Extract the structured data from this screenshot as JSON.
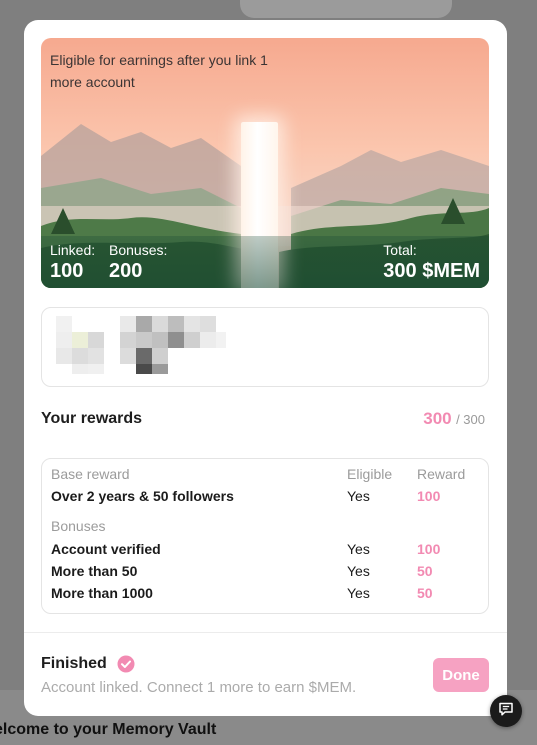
{
  "hero": {
    "eligibility_text": "Eligible for earnings after you link 1 more account",
    "linked_label": "Linked:",
    "linked_value": "100",
    "bonuses_label": "Bonuses:",
    "bonuses_value": "200",
    "total_label": "Total:",
    "total_value": "300 $MEM"
  },
  "rewards": {
    "title": "Your rewards",
    "score": "300",
    "score_max": "/ 300",
    "score_color": "#f28ab2"
  },
  "table": {
    "base_header": "Base reward",
    "eligible_header": "Eligible",
    "reward_header": "Reward",
    "base_rows": [
      {
        "name": "Over 2 years & 50 followers",
        "eligible": "Yes",
        "reward": "100"
      }
    ],
    "bonuses_header": "Bonuses",
    "bonus_rows": [
      {
        "name": "Account verified",
        "eligible": "Yes",
        "reward": "100"
      },
      {
        "name": "More than 50",
        "eligible": "Yes",
        "reward": "50"
      },
      {
        "name": "More than 1000",
        "eligible": "Yes",
        "reward": "50"
      }
    ]
  },
  "status": {
    "title": "Finished",
    "subtitle": "Account linked. Connect 1 more to earn $MEM.",
    "done_label": "Done",
    "done_color": "#f6a2c2"
  },
  "background": {
    "page_title": "elcome to your Memory Vault"
  },
  "icons": {
    "check": "check-circle-icon",
    "chat": "chat-bubble-icon"
  }
}
